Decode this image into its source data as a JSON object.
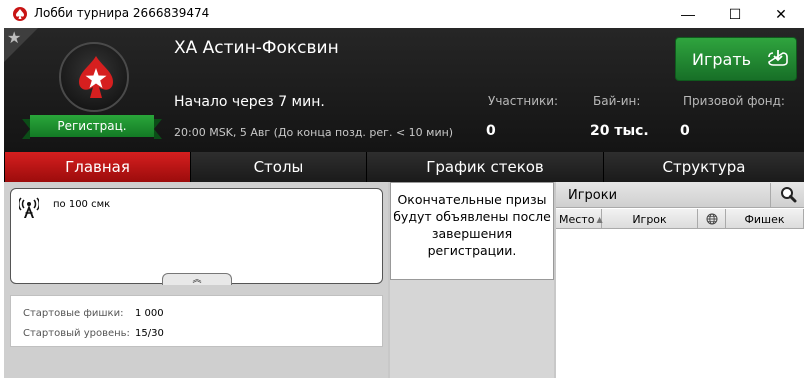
{
  "window": {
    "title": "Лобби турнира 2666839474",
    "min_glyph": "—",
    "max_glyph": "☐",
    "close_glyph": "✕"
  },
  "header": {
    "tournament_name": "ХА Астин-Фоксвин",
    "start_text": "Начало через 7 мин.",
    "detail_text": "20:00 MSK, 5 Авг (До конца позд. рег. < 10 мин)",
    "registration_badge": "Регистрац.",
    "stats": {
      "participants_label": "Участники:",
      "participants_value": "0",
      "buyin_label": "Бай-ин:",
      "buyin_value": "20 тыс.",
      "prize_label": "Призовой фонд:",
      "prize_value": "0"
    },
    "play_button": "Играть"
  },
  "tabs": [
    {
      "label": "Главная",
      "active": true
    },
    {
      "label": "Столы",
      "active": false
    },
    {
      "label": "График стеков",
      "active": false
    },
    {
      "label": "Структура",
      "active": false
    }
  ],
  "left": {
    "game_info": "по 100 смк",
    "expand_glyph": "︽",
    "starting_chips_label": "Стартовые фишки:",
    "starting_chips_value": "1 000",
    "starting_level_label": "Стартовый уровень:",
    "starting_level_value": "15/30"
  },
  "prizes": {
    "note": "Окончательные призы будут объявлены после завершения регистрации."
  },
  "players": {
    "title": "Игроки",
    "columns": [
      "Место",
      "Игрок",
      "",
      "Фишек"
    ]
  },
  "icons": {
    "app": "poker-spade-icon",
    "favorite": "star-icon",
    "logo": "pokerstars-logo-icon",
    "play": "download-icon",
    "game": "antenna-icon",
    "search": "magnifier-icon",
    "globe": "globe-icon"
  },
  "colors": {
    "brand_red": "#d61f1f",
    "play_green": "#2fa43e",
    "header_bg": "#1e1e1e"
  }
}
